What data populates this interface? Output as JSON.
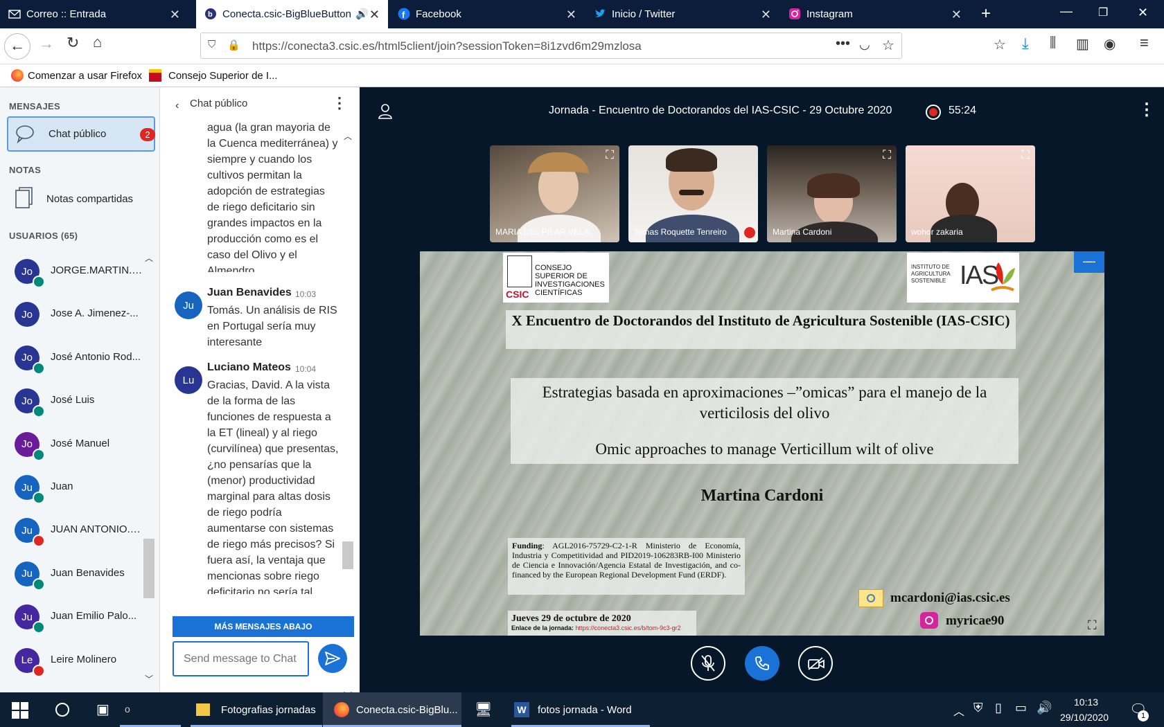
{
  "tabs": [
    {
      "label": "Correo :: Entrada",
      "icon": "mail-icon"
    },
    {
      "label": "Conecta.csic-BigBlueButton",
      "icon": "bigbluebutton-icon",
      "active": true
    },
    {
      "label": "Facebook",
      "icon": "facebook-icon"
    },
    {
      "label": "Inicio / Twitter",
      "icon": "twitter-icon"
    },
    {
      "label": "Instagram",
      "icon": "instagram-icon"
    }
  ],
  "url": "https://conecta3.csic.es/html5client/join?sessionToken=8i1zvd6m29mzlosa",
  "bookmarks": [
    "Comenzar a usar Firefox",
    "Consejo Superior de I..."
  ],
  "sidebar": {
    "messages_header": "MENSAJES",
    "public_chat": "Chat público",
    "public_chat_badge": "2",
    "notes_header": "NOTAS",
    "shared_notes": "Notas compartidas",
    "users_header": "USUARIOS (65)",
    "users": [
      {
        "initials": "Jo",
        "name": "JORGE.MARTIN.B...",
        "color": "#283593",
        "status": "audio"
      },
      {
        "initials": "Jo",
        "name": "Jose A. Jimenez-...",
        "color": "#283593",
        "status": "none"
      },
      {
        "initials": "Jo",
        "name": "José Antonio Rod...",
        "color": "#283593",
        "status": "audio"
      },
      {
        "initials": "Jo",
        "name": "José Luis",
        "color": "#283593",
        "status": "audio"
      },
      {
        "initials": "Jo",
        "name": "José Manuel",
        "color": "#6A1B9A",
        "status": "audio"
      },
      {
        "initials": "Ju",
        "name": "Juan",
        "color": "#1565C0",
        "status": "audio"
      },
      {
        "initials": "Ju",
        "name": "JUAN ANTONIO.N...",
        "color": "#1565C0",
        "status": "muted"
      },
      {
        "initials": "Ju",
        "name": "Juan Benavides",
        "color": "#1565C0",
        "status": "audio"
      },
      {
        "initials": "Ju",
        "name": "Juan Emilio Palo...",
        "color": "#4527A0",
        "status": "audio"
      },
      {
        "initials": "Le",
        "name": "Leire Molinero",
        "color": "#4527A0",
        "status": "muted"
      }
    ]
  },
  "chat": {
    "title": "Chat público",
    "fragment": "agua (la gran mayoria de la Cuenca mediterránea) y siempre y cuando los cultivos permitan la adopción de estrategias de riego deficitario sin grandes impactos en la producción como es el caso del Olivo y el Almendro.",
    "messages": [
      {
        "initials": "Ju",
        "author": "Juan Benavides",
        "time": "10:03",
        "text": "Tomás. Un análisis de RIS en Portugal sería muy interesante"
      },
      {
        "initials": "Lu",
        "author": "Luciano Mateos",
        "time": "10:04",
        "text": "Gracias, David. A la vista de la forma de las funciones de respuesta a la ET (lineal) y al riego (curvilínea) que presentas, ¿no pensarías que la (menor) productividad marginal para altas dosis de riego podría aumentarse con sistemas de riego más precisos? Si fuera así, la ventaja que mencionas sobre riego deficitario no sería tal..."
      }
    ],
    "more_below": "MÁS MENSAJES ABAJO",
    "input_placeholder": "Send message to Chat"
  },
  "meeting": {
    "title": "Jornada - Encuentro de Doctorandos del IAS-CSIC - 29 Octubre 2020 -...",
    "timer": "55:24",
    "videos": [
      {
        "name": "MARIA DEL PILAR.VELA..."
      },
      {
        "name": "Tomas Roquette Tenreiro"
      },
      {
        "name": "Martina Cardoni"
      },
      {
        "name": "wohor zakaria"
      }
    ]
  },
  "slide": {
    "csic_logo_text": "CONSEJO SUPERIOR DE INVESTIGACIONES CIENTÍFICAS",
    "csic_abbr": "CSIC",
    "ias_logo_text": "INSTITUTO DE AGRICULTURA SOSTENIBLE",
    "ias_abbr": "IAS",
    "title": "X Encuentro de Doctorandos del Instituto de Agricultura Sostenible (IAS-CSIC)",
    "subtitle_es": "Estrategias basada en aproximaciones –”omicas” para el manejo de la verticilosis del olivo",
    "subtitle_en": "Omic approaches to manage Verticillum wilt of olive",
    "author": "Martina Cardoni",
    "funding_label": "Funding",
    "funding_text": ": AGL2016-75729-C2-1-R Ministerio de Economía, Industria y Competitividad and PID2019-106283RB-I00 Ministerio de Ciencia e Innovación/Agencia Estatal de Investigación, and co-financed by the European Regional Development Fund (ERDF).",
    "date": "Jueves 29 de octubre de 2020",
    "link_label": "Enlace de la jornada:",
    "link": "https://conecta3.csic.es/b/tom-9c3-gr2",
    "email": "mcardoni@ias.csic.es",
    "instagram": "myricae90"
  },
  "taskbar": {
    "items": [
      "Fotografias jornadas",
      "Conecta.csic-BigBlu...",
      "fotos jornada - Word"
    ],
    "time": "10:13",
    "date": "29/10/2020",
    "notif": "1"
  }
}
